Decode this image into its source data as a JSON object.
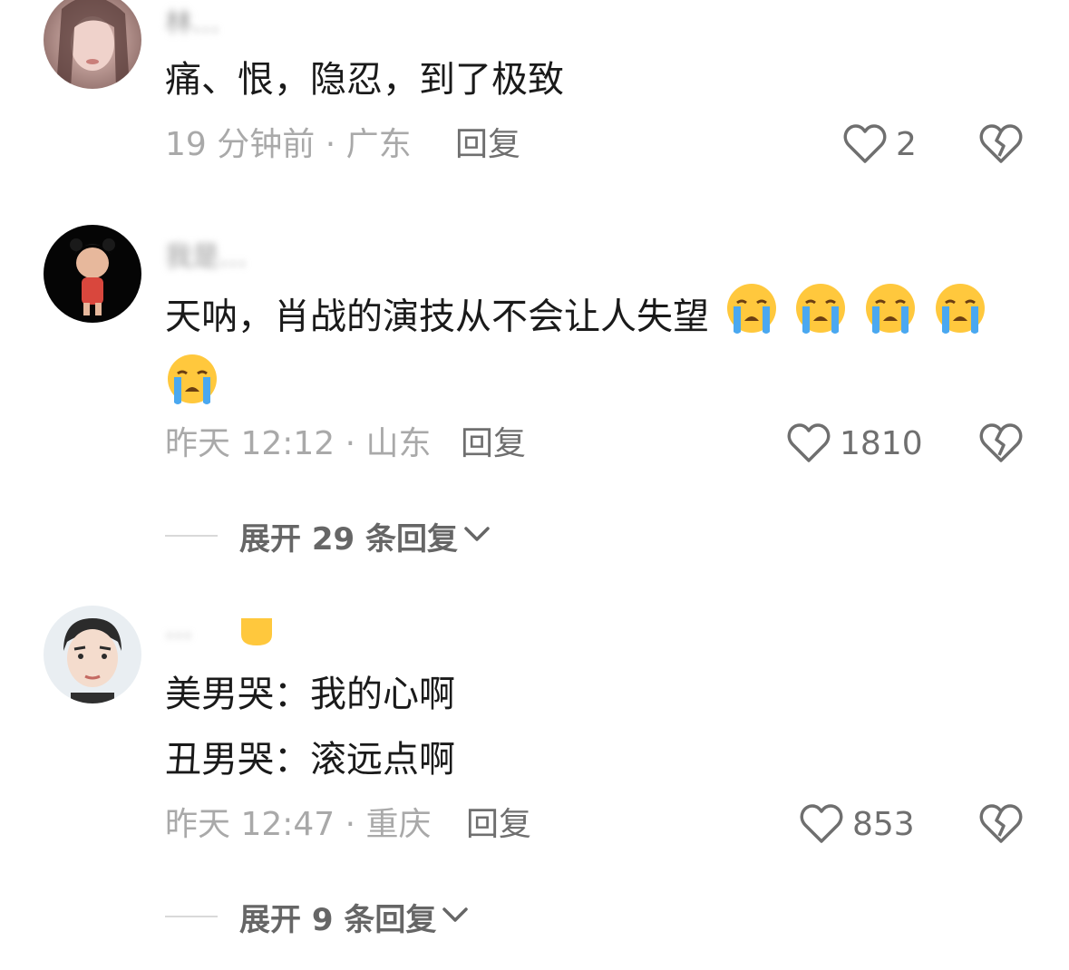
{
  "comments": [
    {
      "username": "林…",
      "text": "痛、恨，隐忍，到了极致",
      "time": "19 分钟前 · 广东",
      "reply_label": "回复",
      "likes": "2"
    },
    {
      "username": "我是…",
      "text": "天呐，肖战的演技从不会让人失望",
      "emoji": "crying-face",
      "time": "昨天 12:12 · 山东",
      "reply_label": "回复",
      "likes": "1810",
      "expand_label": "展开 29 条回复"
    },
    {
      "username": "…",
      "text_line1": "美男哭：我的心啊",
      "text_line2": "丑男哭：滚远点啊",
      "time": "昨天 12:47 · 重庆",
      "reply_label": "回复",
      "likes": "853",
      "expand_label": "展开 9 条回复"
    }
  ],
  "colors": {
    "text": "#1a1a1a",
    "meta": "#a9a9a9",
    "action": "#6f6f6f",
    "emoji_face": "#ffc83d",
    "emoji_tear": "#4aa8f0"
  }
}
